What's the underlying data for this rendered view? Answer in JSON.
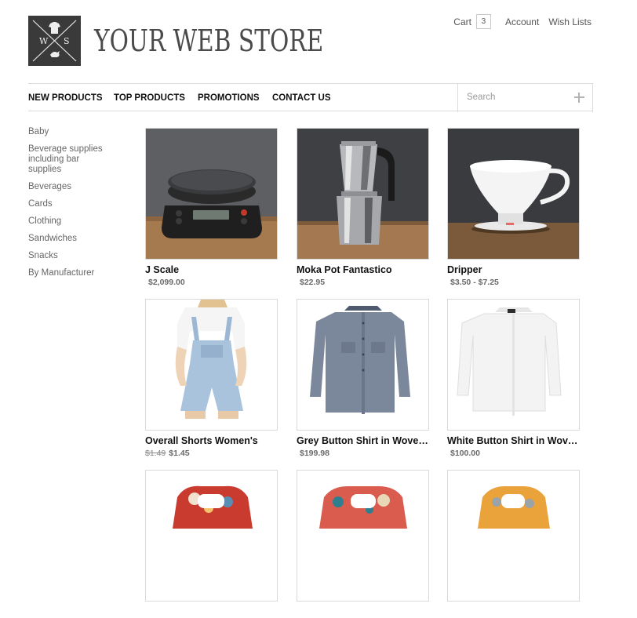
{
  "header": {
    "logo_letters": [
      "W",
      "S"
    ],
    "store_name": "YOUR WEB STORE",
    "cart_label": "Cart",
    "cart_count": "3",
    "account_label": "Account",
    "wishlists_label": "Wish Lists"
  },
  "nav": {
    "items": [
      "NEW PRODUCTS",
      "TOP PRODUCTS",
      "PROMOTIONS",
      "CONTACT US"
    ],
    "search_placeholder": "Search"
  },
  "sidebar": {
    "categories": [
      "Baby",
      "Beverage supplies including bar supplies",
      "Beverages",
      "Cards",
      "Clothing",
      "Sandwiches",
      "Snacks",
      "By Manufacturer"
    ]
  },
  "products": [
    {
      "name": "J Scale",
      "price": "$2,099.00",
      "old_price": ""
    },
    {
      "name": "Moka Pot Fantastico",
      "price": "$22.95",
      "old_price": ""
    },
    {
      "name": "Dripper",
      "price": "$3.50 - $7.25",
      "old_price": ""
    },
    {
      "name": "Overall Shorts Women's",
      "price": "$1.45",
      "old_price": "$1.49"
    },
    {
      "name": "Grey Button Shirt in Woven…",
      "price": "$199.98",
      "old_price": ""
    },
    {
      "name": "White Button Shirt in Wove…",
      "price": "$100.00",
      "old_price": ""
    },
    {
      "name": "",
      "price": "",
      "old_price": ""
    },
    {
      "name": "",
      "price": "",
      "old_price": ""
    },
    {
      "name": "",
      "price": "",
      "old_price": ""
    }
  ]
}
